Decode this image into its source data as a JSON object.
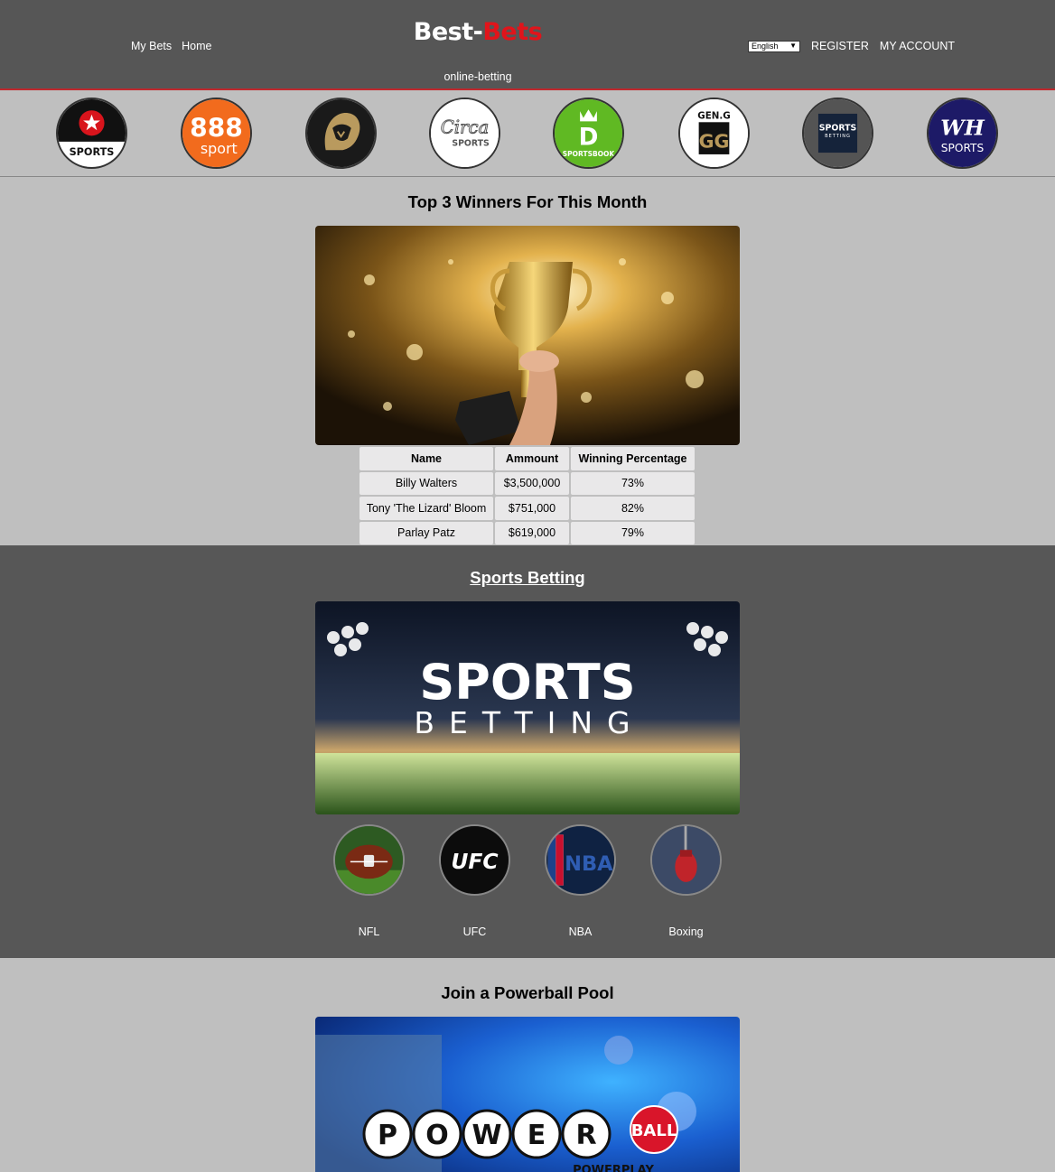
{
  "header": {
    "nav_left": [
      "My Bets",
      "Home"
    ],
    "brand_part1": "Best-",
    "brand_part2": "Bets",
    "tagline": "online-betting",
    "language": "English",
    "register": "REGISTER",
    "account": "MY ACCOUNT"
  },
  "sportsbooks": [
    {
      "name": "PokerStars Sports",
      "text": "SPORTS"
    },
    {
      "name": "888 sport",
      "text1": "888",
      "text2": "sport"
    },
    {
      "name": "BetMGM",
      "text": ""
    },
    {
      "name": "Circa Sports",
      "text1": "Circa",
      "text2": "SPORTS"
    },
    {
      "name": "DraftKings Sportsbook",
      "text1": "D",
      "text2": "SPORTSBOOK"
    },
    {
      "name": "Gen.G",
      "text1": "GEN.G",
      "text2": "GG"
    },
    {
      "name": "Sports Betting",
      "text1": "SPORTS",
      "text2": "BETTING"
    },
    {
      "name": "William Hill Sports",
      "text1": "WH",
      "text2": "SPORTS"
    }
  ],
  "winners": {
    "title": "Top 3 Winners For This Month",
    "columns": [
      "Name",
      "Ammount",
      "Winning Percentage"
    ],
    "rows": [
      [
        "Billy Walters",
        "$3,500,000",
        "73%"
      ],
      [
        "Tony 'The Lizard' Bloom",
        "$751,000",
        "82%"
      ],
      [
        "Parlay Patz",
        "$619,000",
        "79%"
      ]
    ]
  },
  "sports": {
    "title": "Sports Betting",
    "banner_line1": "SPORTS",
    "banner_line2": "BETTING",
    "categories": [
      {
        "label": "NFL"
      },
      {
        "label": "UFC"
      },
      {
        "label": "NBA"
      },
      {
        "label": "Boxing"
      }
    ]
  },
  "powerball": {
    "title": "Join a Powerball Pool",
    "letters": [
      "P",
      "O",
      "W",
      "E",
      "R"
    ],
    "ball_text": "BALL",
    "play_text": "POWERPLAY"
  }
}
